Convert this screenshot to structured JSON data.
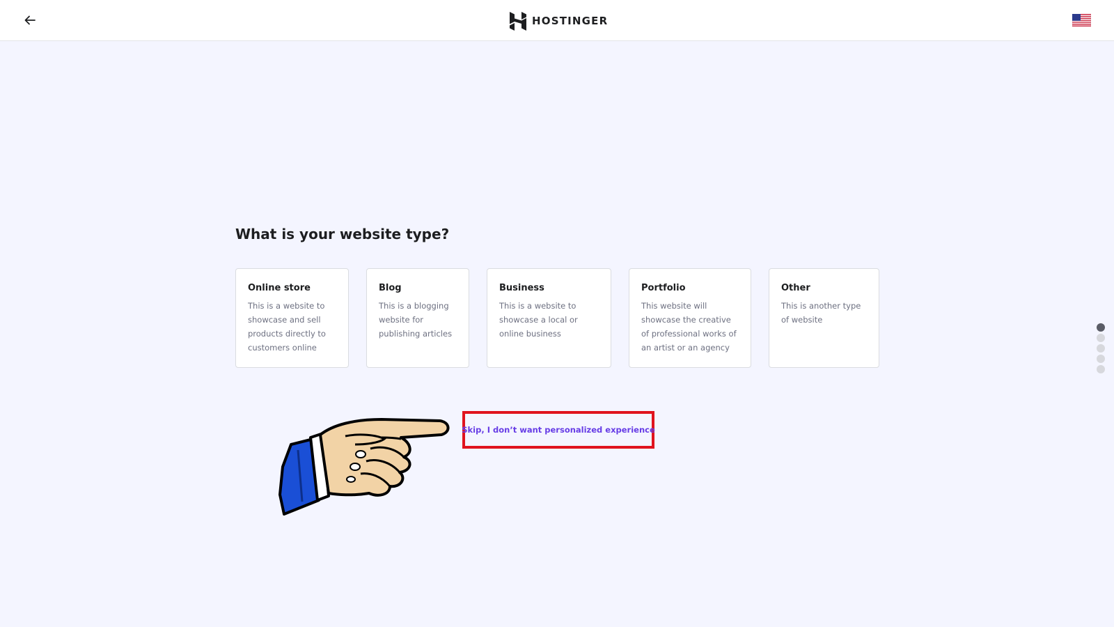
{
  "header": {
    "back_icon": "arrow-left-icon",
    "logo_text": "HOSTINGER",
    "logo_icon": "hostinger-h-icon",
    "language_icon": "us-flag-icon"
  },
  "main": {
    "question": "What is your website type?",
    "options": [
      {
        "title": "Online store",
        "description": "This is a website to showcase and sell products directly to customers online"
      },
      {
        "title": "Blog",
        "description": "This is a blogging website for publishing articles"
      },
      {
        "title": "Business",
        "description": "This is a website to showcase a local or online business"
      },
      {
        "title": "Portfolio",
        "description": "This website will showcase the creative of professional works of an artist or an agency"
      },
      {
        "title": "Other",
        "description": "This is another type of website"
      }
    ],
    "skip_label": "Skip, I don’t want personalized experience"
  },
  "progress": {
    "total_steps": 5,
    "current_step": 1
  },
  "colors": {
    "accent": "#673de6",
    "highlight_box": "#e0141e",
    "background": "#f4f5ff",
    "hand_cuff": "#1a4fd6"
  }
}
